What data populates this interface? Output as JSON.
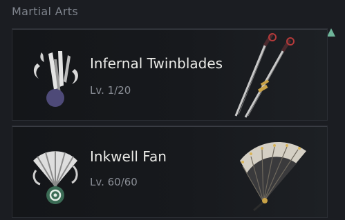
{
  "section": {
    "title": "Martial Arts"
  },
  "martial_arts": [
    {
      "name": "Infernal Twinblades",
      "level": "Lv. 1/20",
      "icon": "twinblades-emblem-icon",
      "art": "twinblades-weapon"
    },
    {
      "name": "Inkwell Fan",
      "level": "Lv. 60/60",
      "icon": "fan-emblem-icon",
      "art": "fan-weapon"
    }
  ],
  "colors": {
    "background": "#1b1d22",
    "card": "#17191d",
    "accent_arrow": "#6fb59a",
    "title_text": "#7e838c",
    "name_text": "#ebebe8",
    "level_text": "#8a8e96",
    "emblem_badge_purple": "#4e4a78",
    "emblem_badge_green": "#3b6b55"
  }
}
